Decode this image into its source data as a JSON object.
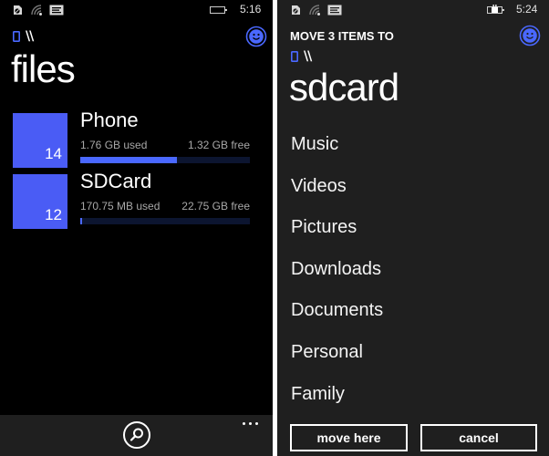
{
  "accent_color": "#4a5cf5",
  "left_screen": {
    "status_bar": {
      "icons": [
        "sim-icon",
        "signal-icon",
        "message-icon",
        "battery-icon"
      ],
      "time": "5:16"
    },
    "breadcrumb": {
      "device_icon": "phone-icon",
      "path": "\\\\"
    },
    "feedback_icon": "smiley-icon",
    "title": "files",
    "storage": [
      {
        "name": "Phone",
        "count": "14",
        "used": "1.76 GB used",
        "free": "1.32 GB free",
        "used_fraction": 0.571
      },
      {
        "name": "SDCard",
        "count": "12",
        "used": "170.75 MB used",
        "free": "22.75 GB free",
        "used_fraction": 0.007
      }
    ],
    "app_bar": {
      "search_icon": "search-icon",
      "more_icon": "ellipsis-icon"
    }
  },
  "right_screen": {
    "status_bar": {
      "icons": [
        "sim-icon",
        "signal-icon",
        "message-icon",
        "battery-charging-icon"
      ],
      "time": "5:24"
    },
    "dialog_title": "MOVE 3 ITEMS TO",
    "breadcrumb": {
      "device_icon": "phone-icon",
      "path": "\\\\"
    },
    "feedback_icon": "smiley-icon",
    "title": "sdcard",
    "folders": [
      "Music",
      "Videos",
      "Pictures",
      "Downloads",
      "Documents",
      "Personal",
      "Family"
    ],
    "buttons": {
      "move_here": "move here",
      "cancel": "cancel"
    }
  }
}
